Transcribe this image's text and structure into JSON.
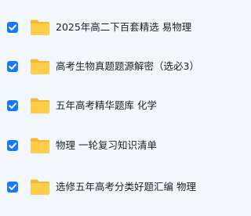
{
  "files": [
    {
      "name": "2025年高二下百套精选 易物理",
      "checked": true,
      "icon": "folder-icon"
    },
    {
      "name": "高考生物真题题源解密（选必3）",
      "checked": true,
      "icon": "folder-icon"
    },
    {
      "name": "五年高考精华题库 化学",
      "checked": true,
      "icon": "folder-icon"
    },
    {
      "name": "物理 一轮复习知识清单",
      "checked": true,
      "icon": "folder-icon"
    },
    {
      "name": "选修五年高考分类好题汇编 物理",
      "checked": true,
      "icon": "folder-icon"
    }
  ],
  "colors": {
    "checkbox": "#1677ff",
    "folder_back": "#f5b82e",
    "folder_front": "#ffcd4a",
    "background": "#f2f7fc"
  }
}
